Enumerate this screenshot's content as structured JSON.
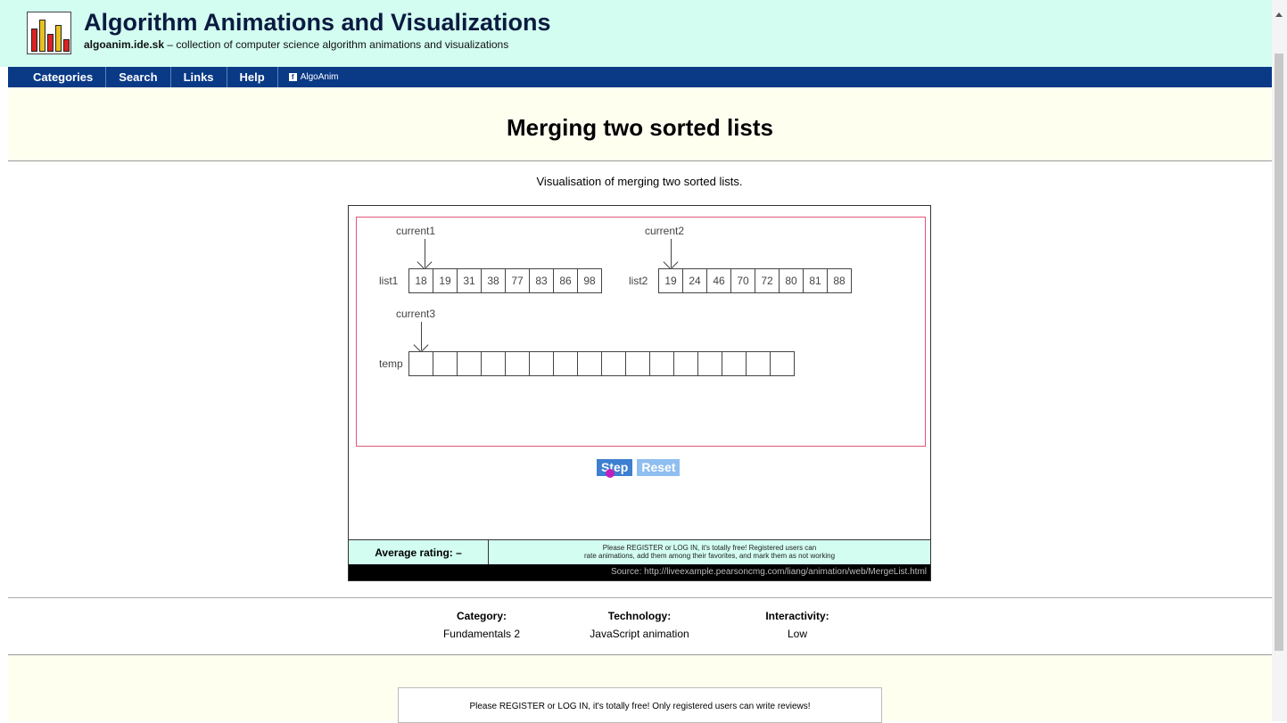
{
  "header": {
    "title": "Algorithm Animations and Visualizations",
    "domain": "algoanim.ide.sk",
    "tagline": " – collection of computer science algorithm animations and visualizations"
  },
  "nav": {
    "items": [
      "Categories",
      "Search",
      "Links",
      "Help"
    ],
    "facebook": "AlgoAnim"
  },
  "page": {
    "title": "Merging two sorted lists",
    "description": "Visualisation of merging two sorted lists."
  },
  "animation": {
    "current1_label": "current1",
    "current2_label": "current2",
    "current3_label": "current3",
    "list1_label": "list1",
    "list2_label": "list2",
    "temp_label": "temp",
    "list1": [
      "18",
      "19",
      "31",
      "38",
      "77",
      "83",
      "86",
      "98"
    ],
    "list2": [
      "19",
      "24",
      "46",
      "70",
      "72",
      "80",
      "81",
      "88"
    ],
    "temp": [
      "",
      "",
      "",
      "",
      "",
      "",
      "",
      "",
      "",
      "",
      "",
      "",
      "",
      "",
      "",
      ""
    ],
    "step_label": "Step",
    "reset_label": "Reset"
  },
  "rating": {
    "label": "Average rating:  –",
    "notice_line1": "Please REGISTER or LOG IN, it's totally free! Registered users can",
    "notice_line2": "rate animations, add them among their favorites, and mark them as not working",
    "source": "Source: http://liveexample.pearsoncmg.com/liang/animation/web/MergeList.html"
  },
  "info": {
    "category_h": "Category:",
    "category_v": "Fundamentals 2",
    "technology_h": "Technology:",
    "technology_v": "JavaScript animation",
    "interactivity_h": "Interactivity:",
    "interactivity_v": "Low"
  },
  "reviews": {
    "notice": "Please REGISTER or LOG IN, it's totally free! Only registered users can write reviews!"
  },
  "colors": {
    "header_bg": "#d2fdf0",
    "nav_bg": "#0a3a86",
    "canvas_border": "#e0567a",
    "step_button": "#3d7fd0",
    "reset_button": "#8fbef0"
  }
}
